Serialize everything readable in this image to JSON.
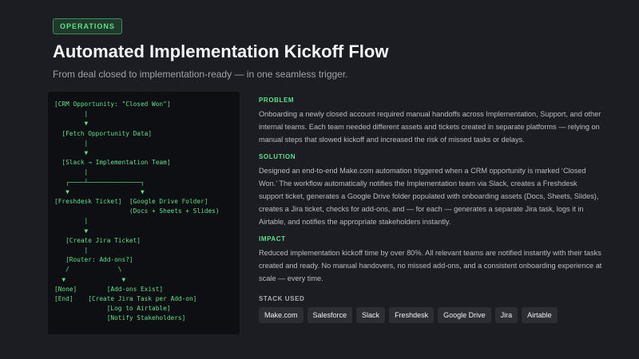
{
  "header": {
    "badge": "OPERATIONS",
    "title": "Automated Implementation Kickoff Flow",
    "subtitle": "From deal closed to implementation-ready — in one seamless trigger."
  },
  "flow_text": "[CRM Opportunity: \"Closed Won\"]\n        |\n        ▼\n  [Fetch Opportunity Data]\n        |\n        ▼\n  [Slack → Implementation Team]\n        |\n   ┌────┴──────────────┐\n   ▼                   ▼\n[Freshdesk Ticket]  [Google Drive Folder]\n                    (Docs + Sheets + Slides)\n        |\n        ▼\n   [Create Jira Ticket]\n        |\n   [Router: Add-ons?]\n   /             \\\n  ▼               ▼\n[None]        [Add-ons Exist]\n[End]    [Create Jira Task per Add-on]\n              [Log to Airtable]\n              [Notify Stakeholders]",
  "sections": {
    "problem": {
      "label": "PROBLEM",
      "text": "Onboarding a newly closed account required manual handoffs across Implementation, Support, and other internal teams. Each team needed different assets and tickets created in separate platforms — relying on manual steps that slowed kickoff and increased the risk of missed tasks or delays."
    },
    "solution": {
      "label": "SOLUTION",
      "text": "Designed an end-to-end Make.com automation triggered when a CRM opportunity is marked ‘Closed Won.’ The workflow automatically notifies the Implementation team via Slack, creates a Freshdesk support ticket, generates a Google Drive folder populated with onboarding assets (Docs, Sheets, Slides), creates a Jira ticket, checks for add-ons, and — for each — generates a separate Jira task, logs it in Airtable, and notifies the appropriate stakeholders instantly."
    },
    "impact": {
      "label": "IMPACT",
      "text": "Reduced implementation kickoff time by over 80%. All relevant teams are notified instantly with their tasks created and ready. No manual handovers, no missed add-ons, and a consistent onboarding experience at scale — every time."
    }
  },
  "stack": {
    "label": "STACK USED",
    "items": [
      "Make.com",
      "Salesforce",
      "Slack",
      "Freshdesk",
      "Google Drive",
      "Jira",
      "Airtable"
    ]
  },
  "colors": {
    "background": "#1c1d22",
    "accent": "#5ee08a",
    "code_bg": "#0e0f13"
  }
}
